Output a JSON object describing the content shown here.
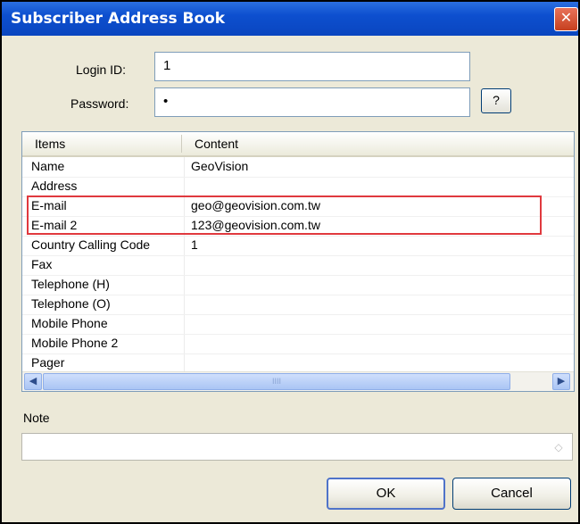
{
  "window": {
    "title": "Subscriber Address Book",
    "close_label": "✕"
  },
  "login": {
    "label": "Login ID:",
    "value": "1"
  },
  "password": {
    "label": "Password:",
    "value": "•"
  },
  "help_button": "?",
  "grid": {
    "headers": {
      "items": "Items",
      "content": "Content"
    },
    "rows": [
      {
        "item": "Name",
        "content": "GeoVision"
      },
      {
        "item": "Address",
        "content": ""
      },
      {
        "item": "E-mail",
        "content": "geo@geovision.com.tw"
      },
      {
        "item": "E-mail 2",
        "content": "123@geovision.com.tw"
      },
      {
        "item": "Country Calling Code",
        "content": "1"
      },
      {
        "item": "Fax",
        "content": ""
      },
      {
        "item": "Telephone (H)",
        "content": ""
      },
      {
        "item": "Telephone (O)",
        "content": ""
      },
      {
        "item": "Mobile Phone",
        "content": ""
      },
      {
        "item": "Mobile Phone 2",
        "content": ""
      },
      {
        "item": "Pager",
        "content": ""
      }
    ],
    "scroll_left": "◀",
    "scroll_right": "▶",
    "scroll_grip": "IIII"
  },
  "note": {
    "label": "Note",
    "value": ""
  },
  "buttons": {
    "ok": "OK",
    "cancel": "Cancel"
  },
  "colors": {
    "highlight": "#e0393e",
    "titlebar": "#0d4fcf"
  }
}
